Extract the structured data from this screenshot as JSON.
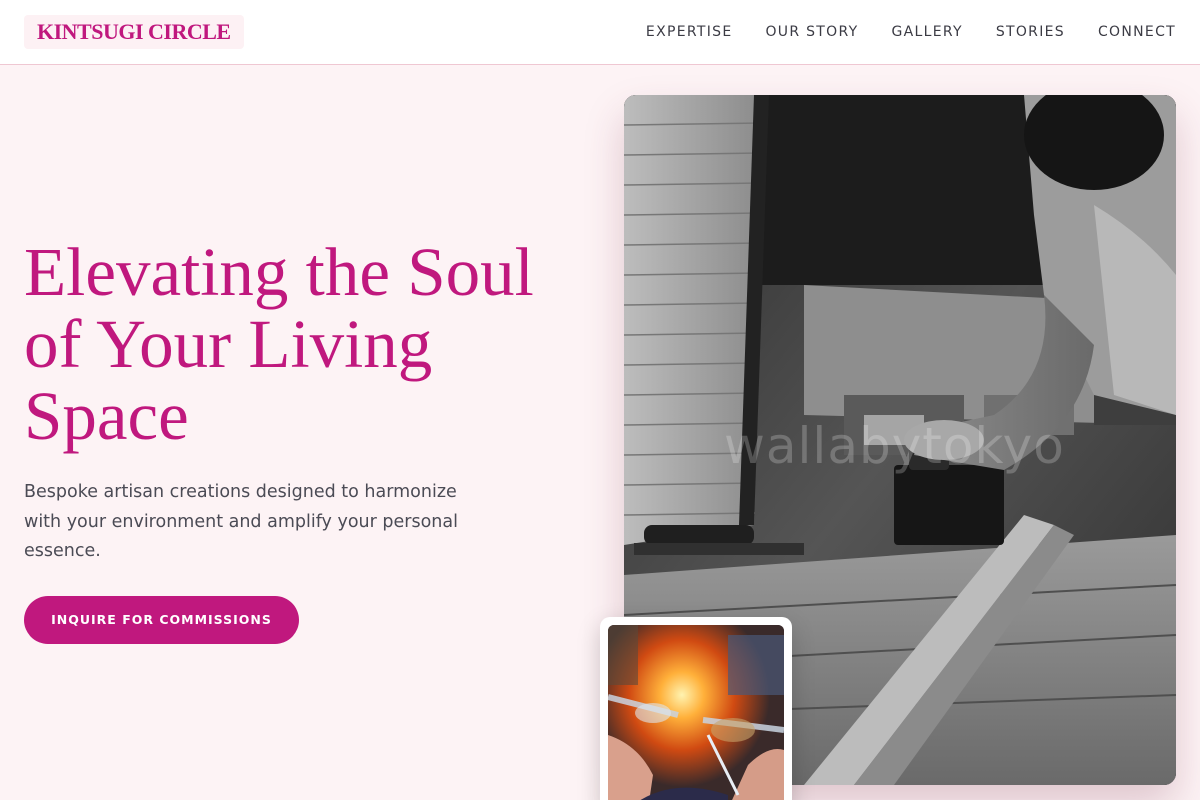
{
  "header": {
    "brand": "KINTSUGI CIRCLE",
    "nav": [
      "EXPERTISE",
      "OUR STORY",
      "GALLERY",
      "STORIES",
      "CONNECT"
    ]
  },
  "hero": {
    "title": "Elevating the Soul of Your Living Space",
    "subtitle": "Bespoke artisan creations designed to harmonize with your environment and amplify your personal essence.",
    "cta_label": "INQUIRE FOR COMMISSIONS"
  },
  "images": {
    "main_watermark": "wallabytokyo"
  },
  "colors": {
    "accent": "#c0187e",
    "background": "#fdf3f5",
    "text": "#4b4b55"
  }
}
